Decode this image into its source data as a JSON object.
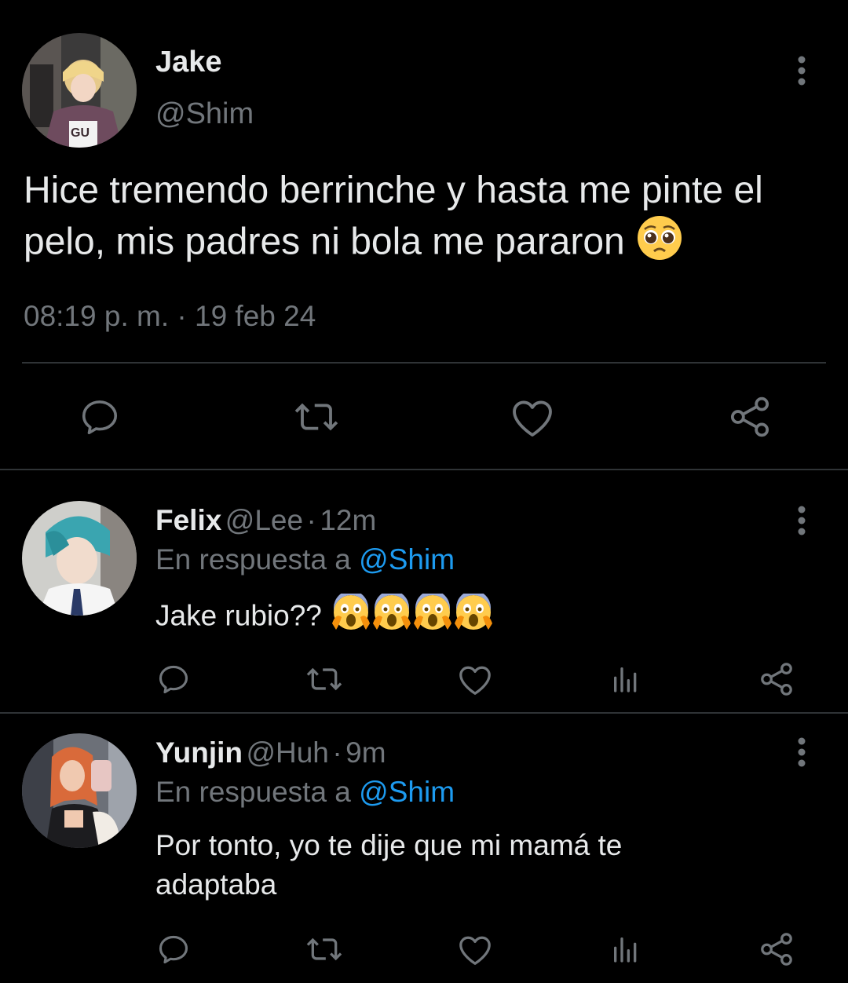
{
  "main_tweet": {
    "author_name": "Jake",
    "author_handle": "@Shim",
    "text_before_emoji": "Hice tremendo berrinche y hasta me pinte el pelo, mis padres ni bola me pararon",
    "emoji": "pleading-face",
    "time": "08:19 p. m.",
    "separator": "·",
    "date": "19 feb 24",
    "actions": [
      "reply-icon",
      "retweet-icon",
      "like-icon",
      "share-icon"
    ]
  },
  "replies": [
    {
      "name": "Felix",
      "handle": "@Lee",
      "separator": "·",
      "age": "12m",
      "replying_label": "En respuesta a",
      "replying_to": "@Shim",
      "text": "Jake rubio??",
      "emojis": [
        "screaming-face",
        "screaming-face",
        "screaming-face",
        "screaming-face"
      ],
      "actions": [
        "reply-icon",
        "retweet-icon",
        "like-icon",
        "analytics-icon",
        "share-icon"
      ]
    },
    {
      "name": "Yunjin",
      "handle": "@Huh",
      "separator": "·",
      "age": "9m",
      "replying_label": "En respuesta a",
      "replying_to": "@Shim",
      "text": "Por tonto, yo te dije que mi mamá te adaptaba",
      "actions": [
        "reply-icon",
        "retweet-icon",
        "like-icon",
        "analytics-icon",
        "share-icon"
      ]
    }
  ],
  "colors": {
    "background": "#000000",
    "text_primary": "#e7e9ea",
    "text_secondary": "#71767b",
    "link": "#1d9bf0",
    "divider": "#2f3336"
  }
}
